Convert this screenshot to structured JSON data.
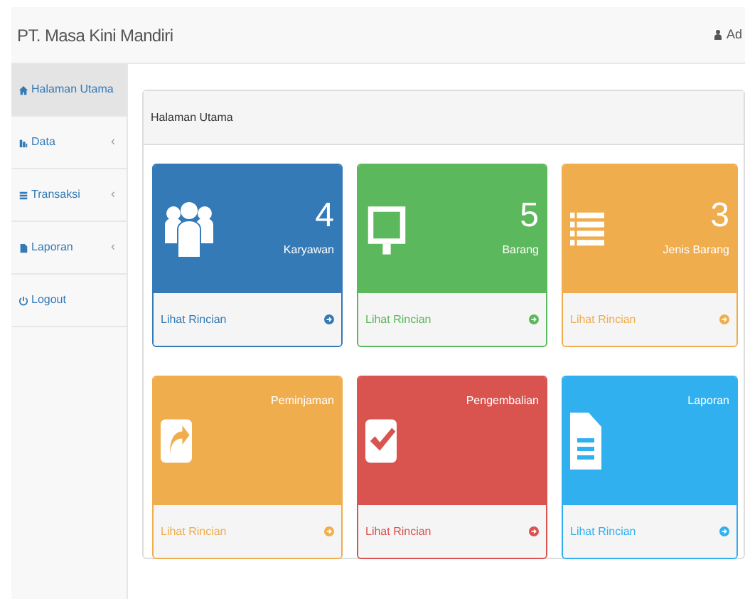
{
  "navbar": {
    "brand": "PT. Masa Kini Mandiri",
    "user": "Ad"
  },
  "sidebar": {
    "items": [
      {
        "label": "Halaman Utama",
        "selected": true
      },
      {
        "label": "Data",
        "caret": "‹",
        "selected": false
      },
      {
        "label": "Transaksi",
        "caret": "‹",
        "selected": false
      },
      {
        "label": "Laporan",
        "caret": "‹",
        "selected": false
      },
      {
        "label": "Logout",
        "selected": false
      }
    ]
  },
  "panel": {
    "heading": "Halaman Utama",
    "cards": [
      {
        "color": "#337ab7",
        "count": "4",
        "label": "Karyawan",
        "link": "Lihat Rincian"
      },
      {
        "color": "#5cb85c",
        "count": "5",
        "label": "Barang",
        "link": "Lihat Rincian"
      },
      {
        "color": "#f0ad4e",
        "count": "3",
        "label": "Jenis Barang",
        "link": "Lihat Rincian"
      },
      {
        "color": "#f0ad4e",
        "label": "Peminjaman",
        "link": "Lihat Rincian"
      },
      {
        "color": "#d9534f",
        "label": "Pengembalian",
        "link": "Lihat Rincian"
      },
      {
        "color": "#31b0f0",
        "label": "Laporan",
        "link": "Lihat Rincian"
      }
    ]
  }
}
